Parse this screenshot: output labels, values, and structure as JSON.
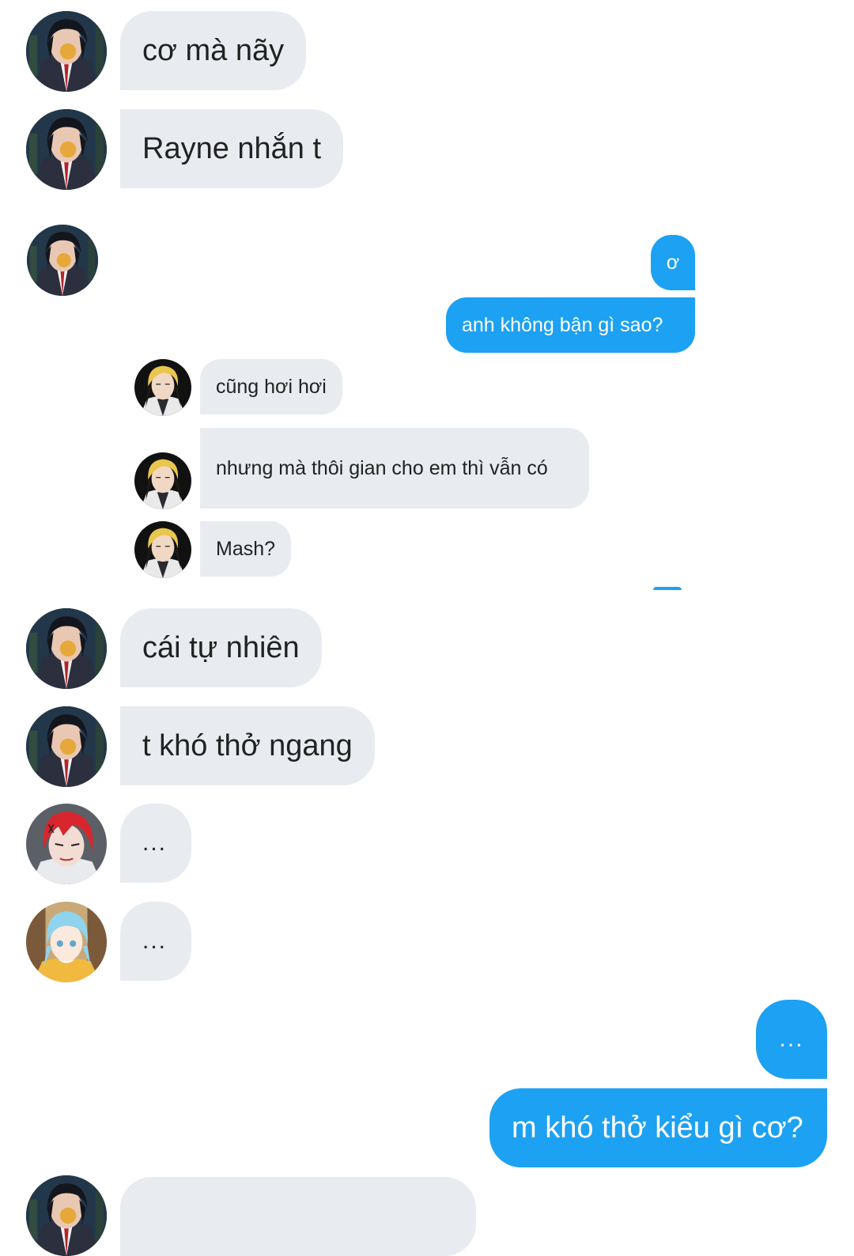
{
  "colors": {
    "incoming_bubble": "#e8ecf1",
    "outgoing_bubble": "#1da1f2",
    "incoming_text": "#222222",
    "outgoing_text": "#ffffff"
  },
  "messages": [
    {
      "sender": "dark-haired-avatar",
      "text": "cơ mà nãy"
    },
    {
      "sender": "dark-haired-avatar",
      "text": "Rayne nhắn t"
    },
    {
      "sender": "self",
      "text": "ơ"
    },
    {
      "sender": "self",
      "text": "anh không bận gì sao?"
    },
    {
      "sender": "blonde-avatar",
      "text": "cũng hơi hơi"
    },
    {
      "sender": "blonde-avatar",
      "text": "nhưng mà thôi gian cho em thì vẫn có"
    },
    {
      "sender": "blonde-avatar",
      "text": "Mash?"
    },
    {
      "sender": "dark-haired-avatar",
      "text": "cái tự nhiên"
    },
    {
      "sender": "dark-haired-avatar",
      "text": "t khó thở ngang"
    },
    {
      "sender": "red-haired-avatar",
      "text": "..."
    },
    {
      "sender": "blue-haired-avatar",
      "text": "..."
    },
    {
      "sender": "self",
      "text": "..."
    },
    {
      "sender": "self",
      "text": "m khó thở kiểu gì cơ?"
    }
  ]
}
